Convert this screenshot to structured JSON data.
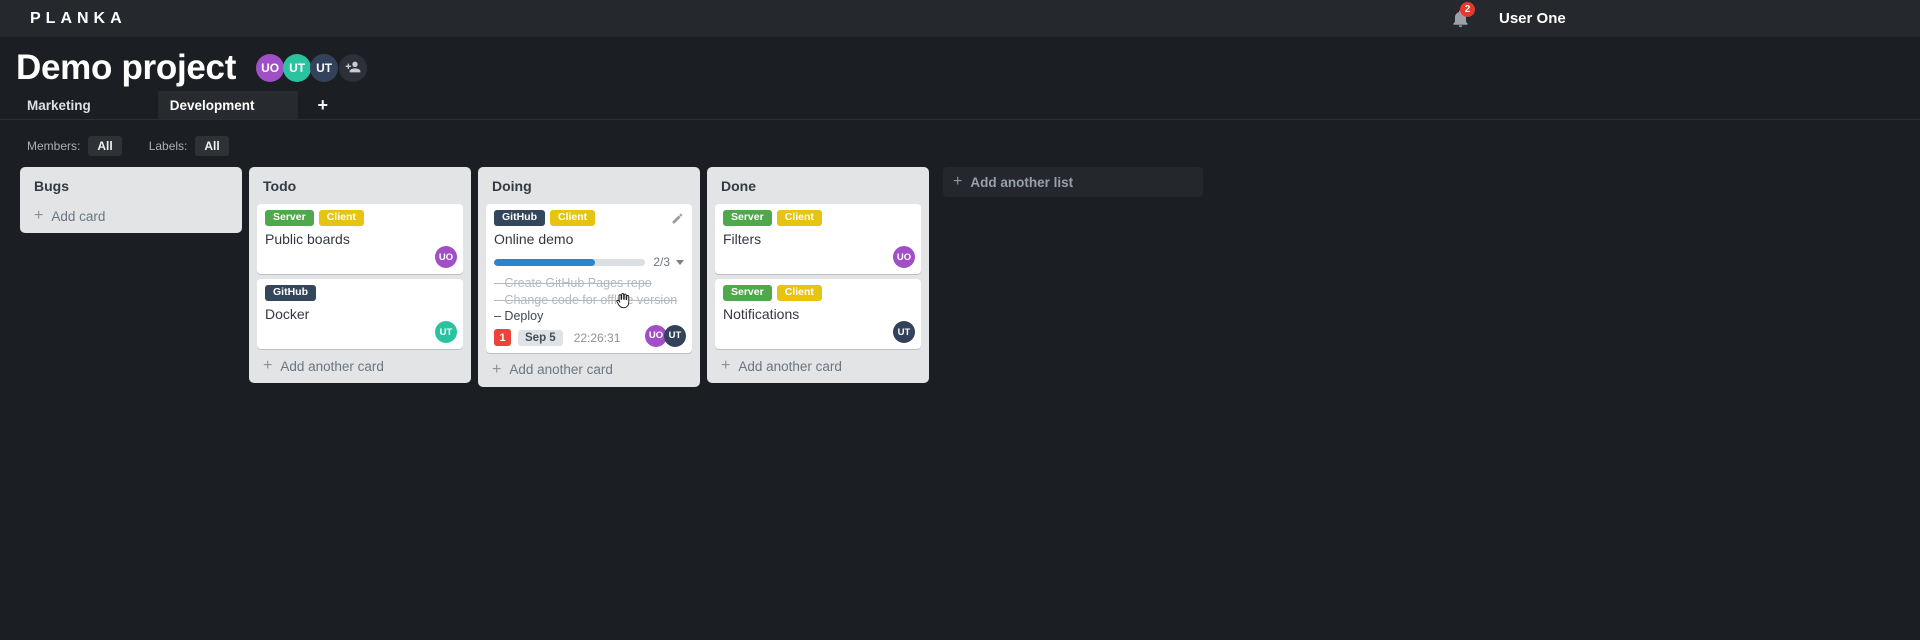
{
  "app": {
    "logo": "PLANKA",
    "notification_count": "2",
    "user_name": "User One"
  },
  "project": {
    "title": "Demo project",
    "members": [
      {
        "initials": "UO",
        "color": "#a04fc7"
      },
      {
        "initials": "UT",
        "color": "#29c3a0"
      },
      {
        "initials": "UT",
        "color": "#33425b"
      }
    ]
  },
  "tabs": {
    "items": [
      {
        "label": "Marketing",
        "active": false
      },
      {
        "label": "Development",
        "active": true
      }
    ],
    "add_icon": "+"
  },
  "filters": {
    "members_label": "Members:",
    "members_value": "All",
    "labels_label": "Labels:",
    "labels_value": "All"
  },
  "label_colors": {
    "Server": "#4fa94c",
    "Client": "#e7c411",
    "GitHub": "#33465b"
  },
  "board": {
    "add_list_label": "Add another list",
    "plus_icon": "+",
    "task_bullet": "–",
    "lists": [
      {
        "name": "Bugs",
        "add_label": "Add card",
        "cards": []
      },
      {
        "name": "Todo",
        "add_label": "Add another card",
        "cards": [
          {
            "title": "Public boards",
            "labels": [
              "Server",
              "Client"
            ],
            "avatars": [
              {
                "initials": "UO",
                "color": "#a04fc7"
              }
            ]
          },
          {
            "title": "Docker",
            "labels": [
              "GitHub"
            ],
            "avatars": [
              {
                "initials": "UT",
                "color": "#29c3a0"
              }
            ]
          }
        ]
      },
      {
        "name": "Doing",
        "add_label": "Add another card",
        "cards": [
          {
            "title": "Online demo",
            "labels": [
              "GitHub",
              "Client"
            ],
            "edit_icon": true,
            "progress": {
              "done": 2,
              "total": 3,
              "text": "2/3"
            },
            "tasks": [
              {
                "text": "Create GitHub Pages repo",
                "done": true
              },
              {
                "text": "Change code for offline version",
                "done": true
              },
              {
                "text": "Deploy",
                "done": false
              }
            ],
            "notification_count": "1",
            "due_date": "Sep 5",
            "timer": "22:26:31",
            "avatars": [
              {
                "initials": "UO",
                "color": "#a04fc7"
              },
              {
                "initials": "UT",
                "color": "#33425b"
              }
            ]
          }
        ]
      },
      {
        "name": "Done",
        "add_label": "Add another card",
        "cards": [
          {
            "title": "Filters",
            "labels": [
              "Server",
              "Client"
            ],
            "avatars": [
              {
                "initials": "UO",
                "color": "#a04fc7"
              }
            ]
          },
          {
            "title": "Notifications",
            "labels": [
              "Server",
              "Client"
            ],
            "avatars": [
              {
                "initials": "UT",
                "color": "#33425b"
              }
            ]
          }
        ]
      }
    ]
  }
}
